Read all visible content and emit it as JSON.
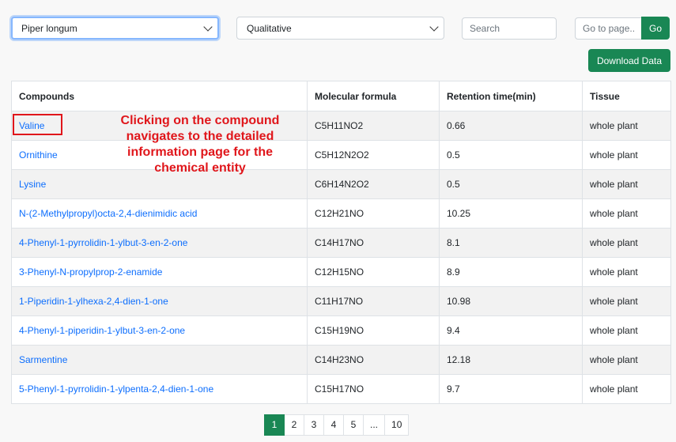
{
  "filters": {
    "species_value": "Piper longum",
    "analysis_value": "Qualitative",
    "search_placeholder": "Search",
    "goto_placeholder": "Go to page..",
    "go_label": "Go",
    "download_label": "Download Data"
  },
  "table": {
    "headers": [
      "Compounds",
      "Molecular formula",
      "Retention time(min)",
      "Tissue"
    ],
    "rows": [
      {
        "compound": "Valine",
        "formula": "C5H11NO2",
        "rt": "0.66",
        "tissue": "whole plant"
      },
      {
        "compound": "Ornithine",
        "formula": "C5H12N2O2",
        "rt": "0.5",
        "tissue": "whole plant"
      },
      {
        "compound": "Lysine",
        "formula": "C6H14N2O2",
        "rt": "0.5",
        "tissue": "whole plant"
      },
      {
        "compound": "N-(2-Methylpropyl)octa-2,4-dienimidic acid",
        "formula": "C12H21NO",
        "rt": "10.25",
        "tissue": "whole plant"
      },
      {
        "compound": "4-Phenyl-1-pyrrolidin-1-ylbut-3-en-2-one",
        "formula": "C14H17NO",
        "rt": "8.1",
        "tissue": "whole plant"
      },
      {
        "compound": "3-Phenyl-N-propylprop-2-enamide",
        "formula": "C12H15NO",
        "rt": "8.9",
        "tissue": "whole plant"
      },
      {
        "compound": "1-Piperidin-1-ylhexa-2,4-dien-1-one",
        "formula": "C11H17NO",
        "rt": "10.98",
        "tissue": "whole plant"
      },
      {
        "compound": "4-Phenyl-1-piperidin-1-ylbut-3-en-2-one",
        "formula": "C15H19NO",
        "rt": "9.4",
        "tissue": "whole plant"
      },
      {
        "compound": "Sarmentine",
        "formula": "C14H23NO",
        "rt": "12.18",
        "tissue": "whole plant"
      },
      {
        "compound": "5-Phenyl-1-pyrrolidin-1-ylpenta-2,4-dien-1-one",
        "formula": "C15H17NO",
        "rt": "9.7",
        "tissue": "whole plant"
      }
    ]
  },
  "annotation": "Clicking on the compound navigates to the detailed information page for the chemical entity",
  "pagination": {
    "pages": [
      "1",
      "2",
      "3",
      "4",
      "5",
      "...",
      "10"
    ],
    "active": "1"
  },
  "colors": {
    "accent_green": "#198754",
    "link_blue": "#0d6efd",
    "annotation_red": "#e0161b"
  }
}
